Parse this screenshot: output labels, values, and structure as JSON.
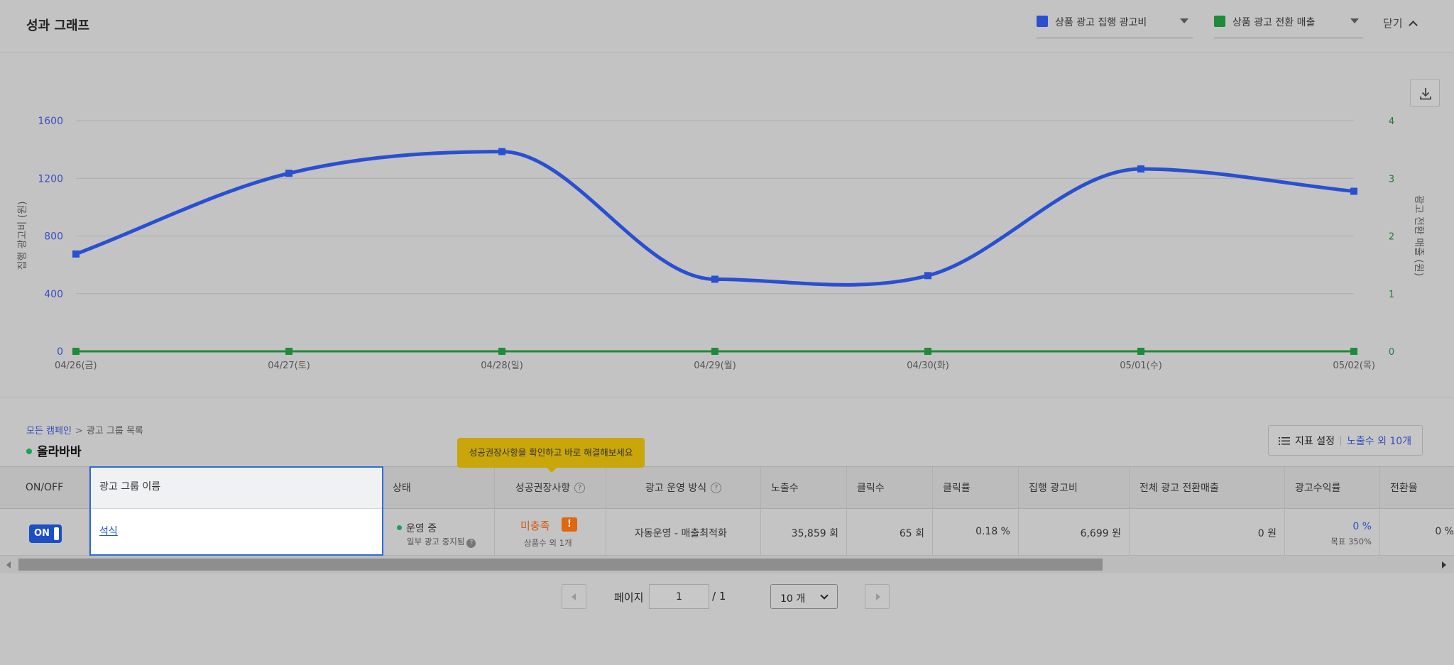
{
  "graph": {
    "title": "성과 그래프",
    "metric_1": {
      "label": "상품 광고 집행 광고비",
      "color": "#2a4fd1"
    },
    "metric_2": {
      "label": "상품 광고 전환 매출",
      "color": "#1e8a3a"
    },
    "close_label": "닫기"
  },
  "chart_data": {
    "type": "line",
    "categories": [
      "04/26(금)",
      "04/27(토)",
      "04/28(일)",
      "04/29(월)",
      "04/30(화)",
      "05/01(수)",
      "05/02(목)"
    ],
    "series": [
      {
        "name": "상품 광고 집행 광고비",
        "axis": "left",
        "color": "#2a4fd1",
        "values": [
          675,
          1235,
          1385,
          500,
          525,
          1265,
          1110
        ]
      },
      {
        "name": "상품 광고 전환 매출",
        "axis": "right",
        "color": "#1e8a3a",
        "values": [
          0,
          0,
          0,
          0,
          0,
          0,
          0
        ]
      }
    ],
    "ylabel": "집행 광고비 (원)",
    "ylabel_right": "광고 전환 매출 (원)",
    "ylim": [
      0,
      1600
    ],
    "ylim_right": [
      0,
      4
    ],
    "yticks": [
      "0",
      "400",
      "800",
      "1200",
      "1600"
    ],
    "yticks_right": [
      "0",
      "1",
      "2",
      "3",
      "4"
    ],
    "grid": true,
    "smooth": true
  },
  "breadcrumb": {
    "root": "모든 캠페인",
    "separator": ">",
    "current": "광고 그룹 목록"
  },
  "campaign": {
    "name": "올라바바",
    "status_color": "#18a35a"
  },
  "metric_settings": {
    "label": "지표 설정",
    "count": "노출수 외 10개"
  },
  "tooltip": "성공권장사항을 확인하고 바로 해결해보세요",
  "table": {
    "headers": {
      "onoff": "ON/OFF",
      "name": "광고 그룹 이름",
      "status": "상태",
      "recommend": "성공권장사항",
      "method": "광고 운영 방식",
      "impressions": "노출수",
      "clicks": "클릭수",
      "ctr": "클릭률",
      "spend": "집행 광고비",
      "revenue": "전체 광고 전환매출",
      "roas": "광고수익률",
      "conversion": "전환율"
    },
    "row": {
      "toggle": "ON",
      "name": "석식",
      "status": "운영 중",
      "status_sub": "일부 광고 중지됨",
      "recommend": "미충족",
      "recommend_badge": "!",
      "recommend_sub": "상품수 외 1개",
      "method": "자동운영 - 매출최적화",
      "impressions": "35,859 회",
      "clicks": "65 회",
      "ctr": "0.18 %",
      "spend": "6,699 원",
      "revenue": "0 원",
      "roas": "0 %",
      "roas_target": "목표 350%",
      "conversion": "0 %"
    }
  },
  "pagination": {
    "label": "페이지",
    "current": "1",
    "total": "/ 1",
    "page_size": "10 개"
  }
}
